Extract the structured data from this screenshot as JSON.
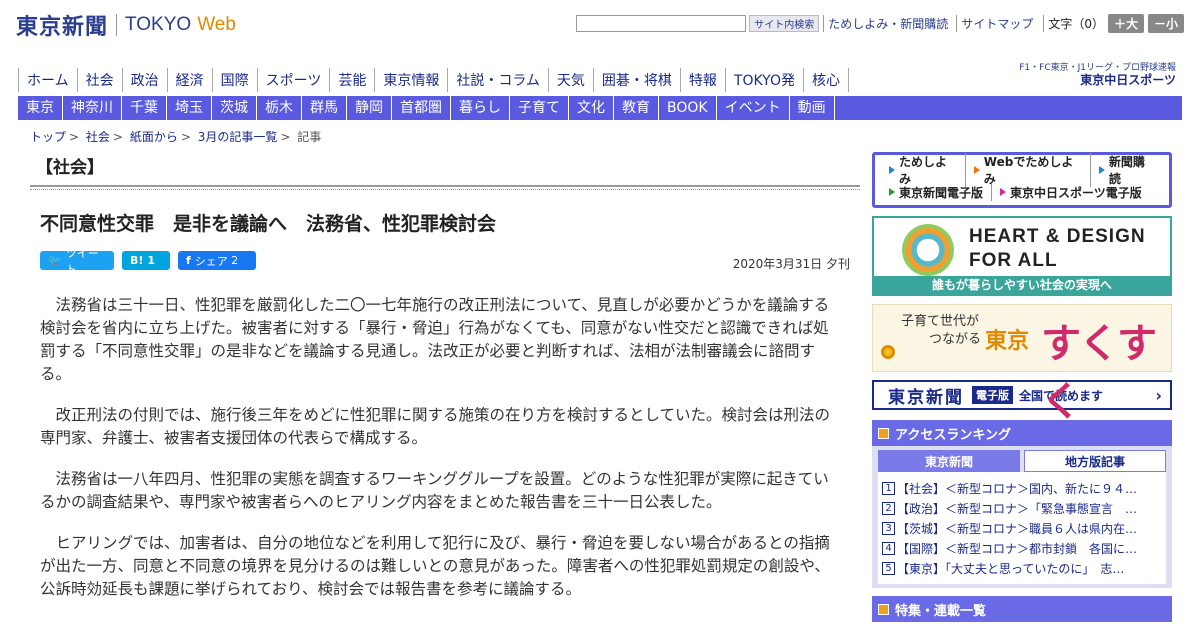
{
  "header": {
    "logo_jp": "東京新聞",
    "logo_en": "TOKYO",
    "logo_web": "Web",
    "search_button": "サイト内検索",
    "links": [
      "ためしよみ・新聞購読",
      "サイトマップ"
    ],
    "font_size_label": "文字（0）",
    "size_up": "＋大",
    "size_down": "－小"
  },
  "nav_main": [
    "ホーム",
    "社会",
    "政治",
    "経済",
    "国際",
    "スポーツ",
    "芸能",
    "東京情報",
    "社説・コラム",
    "天気",
    "囲碁・将棋",
    "特報",
    "TOKYO発",
    "核心"
  ],
  "chunichi": {
    "small": "F1・FC東京・J1リーグ・プロ野球速報",
    "big": "東京中日スポーツ"
  },
  "nav_region": [
    "東京",
    "神奈川",
    "千葉",
    "埼玉",
    "茨城",
    "栃木",
    "群馬",
    "静岡",
    "首都圏",
    "暮らし",
    "子育て",
    "文化",
    "教育",
    "BOOK",
    "イベント",
    "動画"
  ],
  "breadcrumb": [
    "トップ",
    "社会",
    "紙面から",
    "3月の記事一覧",
    "記事"
  ],
  "section_title": "【社会】",
  "article": {
    "headline": "不同意性交罪　是非を議論へ　法務省、性犯罪検討会",
    "date": "2020年3月31日 夕刊",
    "share": {
      "tweet": "ツイート",
      "hatena_icon": "B!",
      "hatena_count": "1",
      "fb_icon": "f",
      "fb_label": "シェア",
      "fb_count": "2"
    },
    "paragraphs": [
      "法務省は三十一日、性犯罪を厳罰化した二〇一七年施行の改正刑法について、見直しが必要かどうかを議論する検討会を省内に立ち上げた。被害者に対する「暴行・脅迫」行為がなくても、同意がない性交だと認識できれば処罰する「不同意性交罪」の是非などを議論する見通し。法改正が必要と判断すれば、法相が法制審議会に諮問する。",
      "改正刑法の付則では、施行後三年をめどに性犯罪に関する施策の在り方を検討するとしていた。検討会は刑法の専門家、弁護士、被害者支援団体の代表らで構成する。",
      "法務省は一八年四月、性犯罪の実態を調査するワーキンググループを設置。どのような性犯罪が実際に起きているかの調査結果や、専門家や被害者らへのヒアリング内容をまとめた報告書を三十一日公表した。",
      "ヒアリングでは、加害者は、自分の地位などを利用して犯行に及び、暴行・脅迫を要しない場合があるとの指摘が出た一方、同意と不同意の境界を見分けるのは難しいとの意見があった。障害者への性犯罪処罰規定の創設や、公訴時効延長も課題に挙げられており、検討会では報告書を参考に議論する。"
    ]
  },
  "sidebar": {
    "promo": {
      "row1": [
        "ためしよみ",
        "Webでためしよみ",
        "新聞購読"
      ],
      "row2": [
        "東京新聞電子版",
        "東京中日スポーツ電子版"
      ]
    },
    "heart": {
      "line1": "HEART & DESIGN",
      "line2": "FOR ALL",
      "bar": "誰もが暮らしやすい社会の実現へ"
    },
    "suku": {
      "small1": "子育て世代が",
      "small2": "つながる",
      "tokyo": "東京",
      "big": "すくすく"
    },
    "denshi": {
      "logo": "東京新聞",
      "tag": "電子版",
      "text": "全国で読めます",
      "arrow": "›"
    },
    "ranking": {
      "title": "アクセスランキング",
      "tabs": [
        "東京新聞",
        "地方版記事"
      ],
      "items": [
        "【社会】＜新型コロナ＞国内、新たに９４…",
        "【政治】＜新型コロナ＞「緊急事態宣言　…",
        "【茨城】＜新型コロナ＞職員６人は県内在…",
        "【国際】＜新型コロナ＞都市封鎖　各国に…",
        "【東京】「大丈夫と思っていたのに」　志…"
      ]
    },
    "feature_title": "特集・連載一覧"
  }
}
